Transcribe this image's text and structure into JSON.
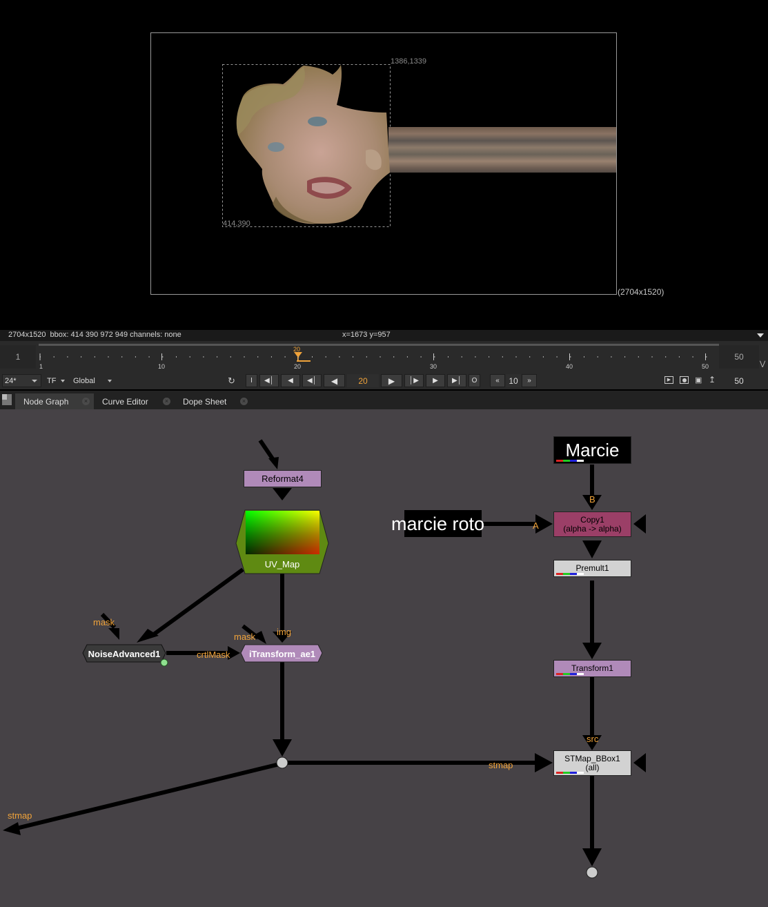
{
  "viewer": {
    "bbox_top_right": "1386,1339",
    "bbox_bottom_left": "414,390",
    "format_label": "(2704x1520)"
  },
  "info_bar": {
    "format_info": "2704x1520  bbox: 414 390 972 949 channels: none",
    "cursor": "x=1673 y=957"
  },
  "timeline": {
    "start_frame": "1",
    "end_frame": "50",
    "current_frame": "20",
    "ticks": [
      "1",
      "10",
      "20",
      "30",
      "40",
      "50"
    ]
  },
  "controls": {
    "fps": "24*",
    "timecode_mode": "TF",
    "range_mode": "Global",
    "in_button": "I",
    "out_button": "O",
    "current_frame": "20",
    "step": "10",
    "end_frame": "50"
  },
  "tabs": [
    {
      "label": "Node Graph",
      "active": true
    },
    {
      "label": "Curve Editor",
      "active": false
    },
    {
      "label": "Dope Sheet",
      "active": false
    }
  ],
  "graph": {
    "nodes": {
      "reformat": "Reformat4",
      "uv_map": "UV_Map",
      "noise": "NoiseAdvanced1",
      "itransform": "iTransform_ae1",
      "marcie": "Marcie",
      "marcie_roto": "marcie roto",
      "copy_title": "Copy1",
      "copy_sub": "(alpha -> alpha)",
      "premult": "Premult1",
      "transform": "Transform1",
      "stmap_title": "STMap_BBox1",
      "stmap_sub": "(all)"
    },
    "labels": {
      "mask1": "mask",
      "mask2": "mask",
      "img": "img",
      "crtlmask": "crtlMask",
      "b": "B",
      "a": "A",
      "src": "src",
      "stmap_in": "stmap",
      "stmap_out": "stmap"
    }
  },
  "colors": {
    "graph_bg": "#464246",
    "purple_node": "#b08ab9",
    "copy_node": "#9b3f67",
    "uv_green": "#5f8a12",
    "pipe_label": "#f0a33a",
    "current_frame": "#f0a33a"
  }
}
